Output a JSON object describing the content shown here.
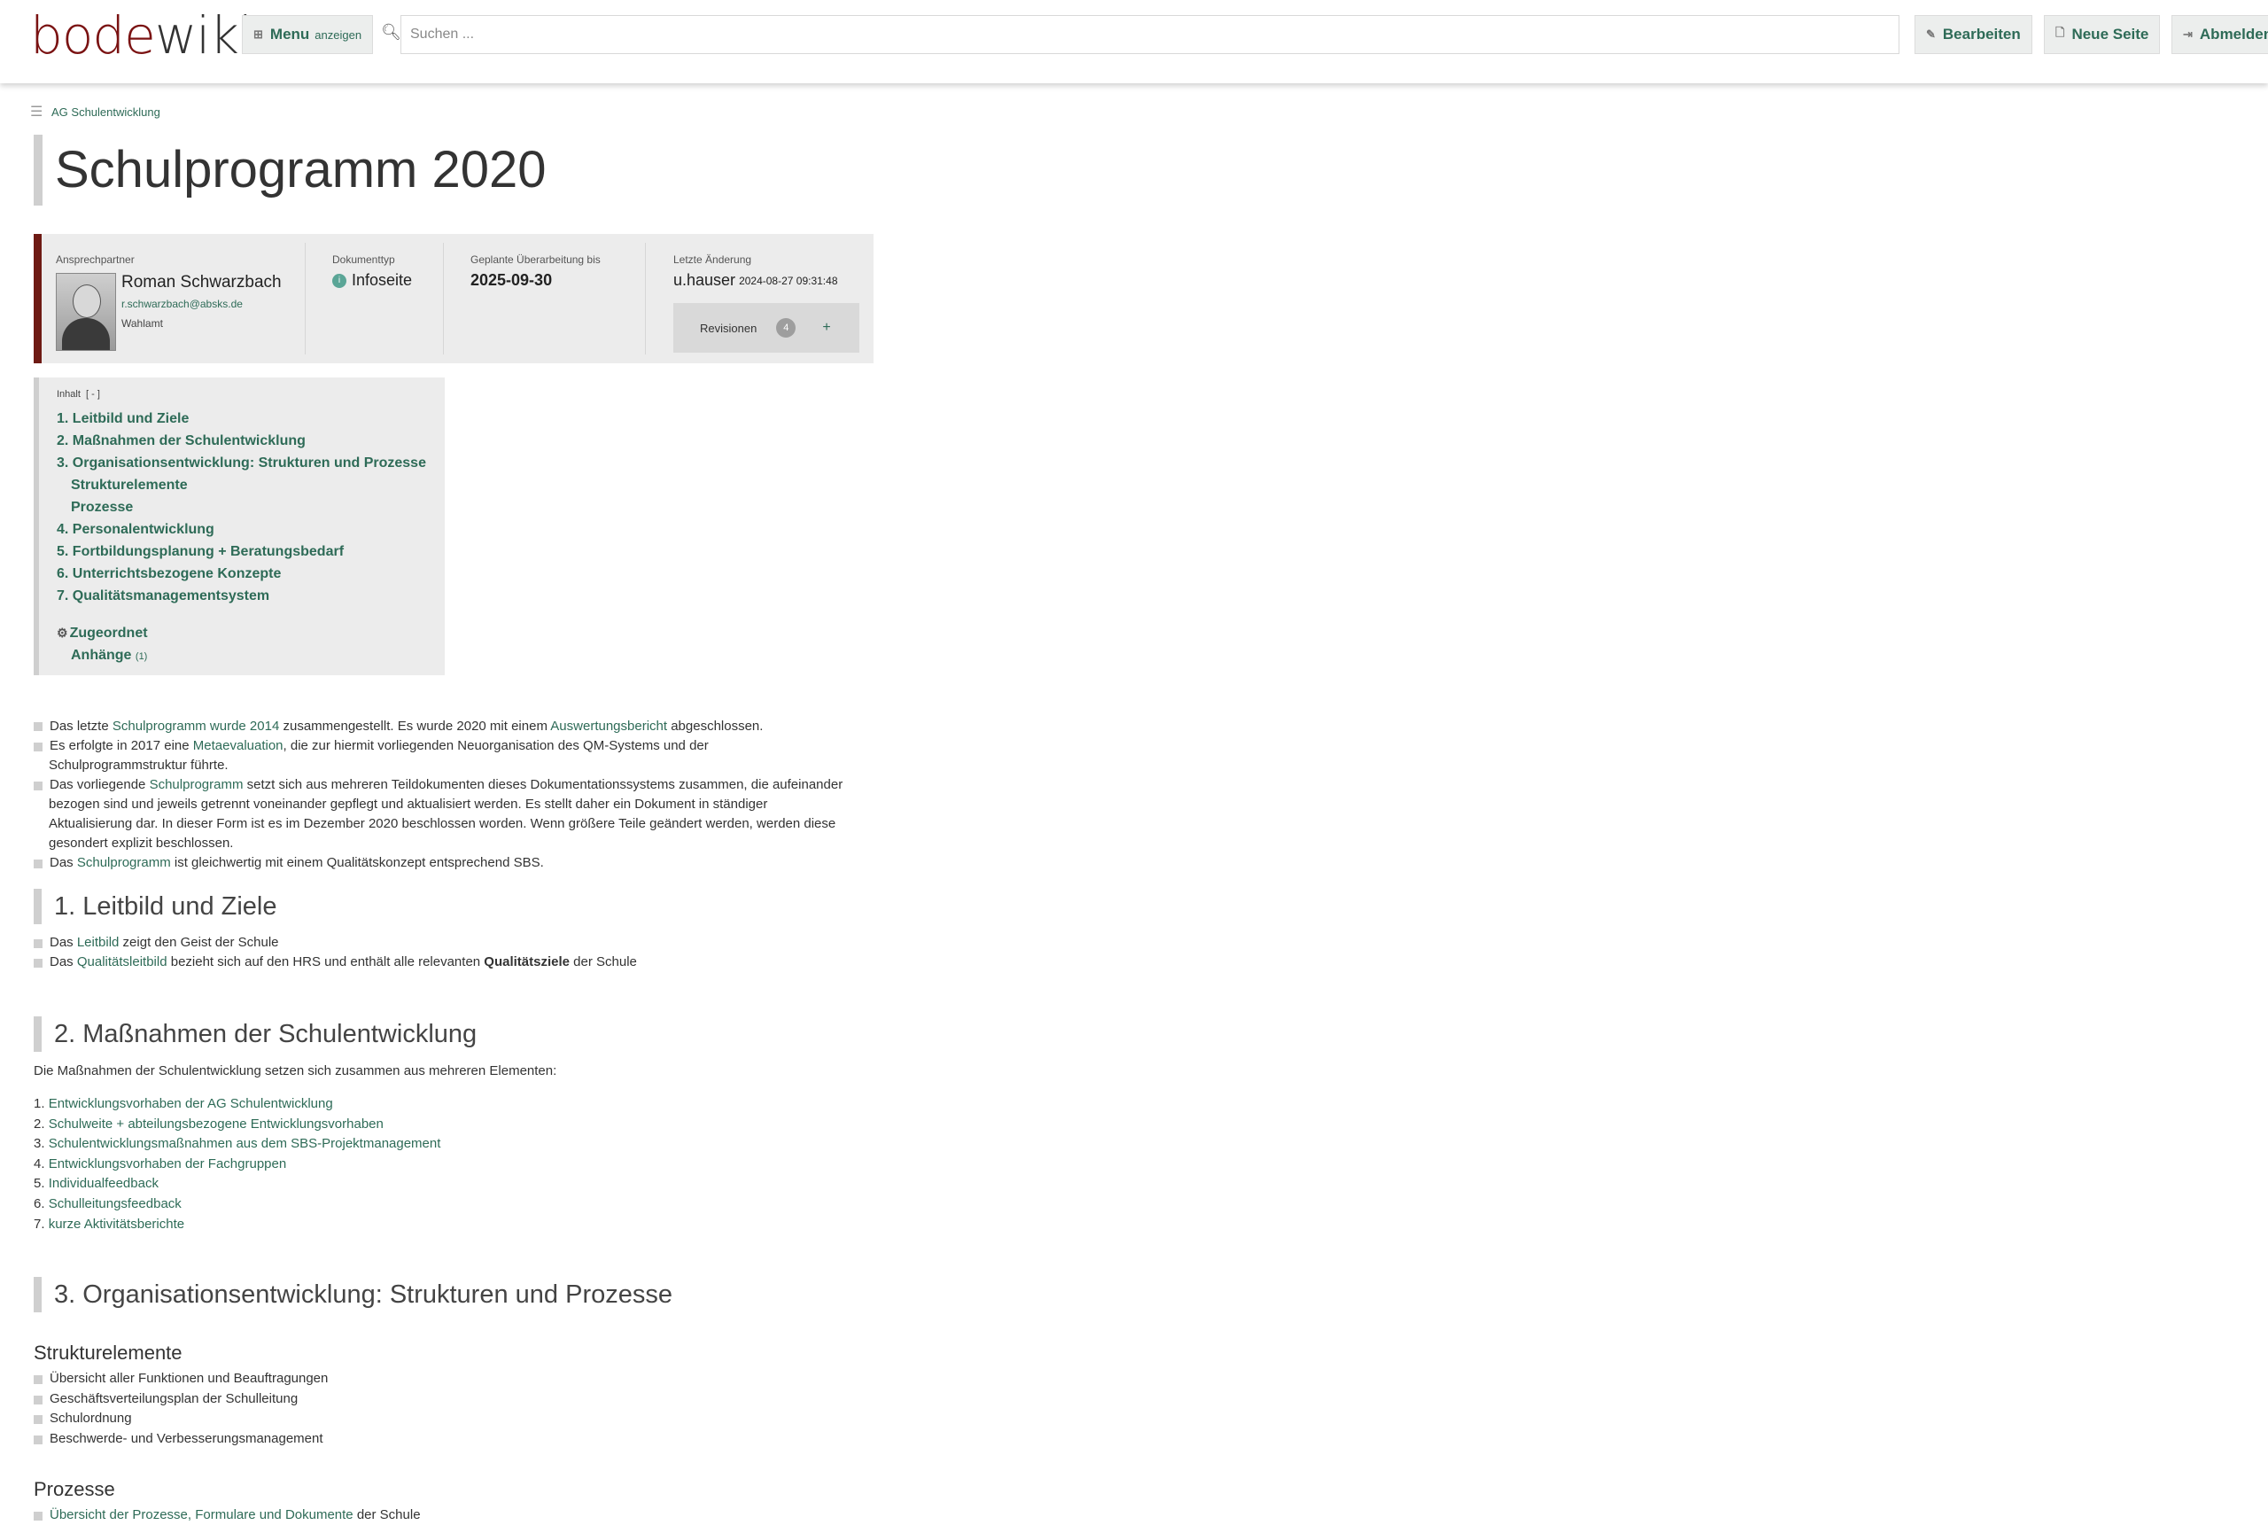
{
  "brand": {
    "part1": "bode",
    "part2": "wiki"
  },
  "header": {
    "menu_label": "Menu",
    "menu_sub": "anzeigen",
    "search_placeholder": "Suchen ...",
    "edit_label": "Bearbeiten",
    "new_page_label": "Neue Seite",
    "logout_label": "Abmelden"
  },
  "breadcrumb": {
    "item": "AG Schulentwicklung"
  },
  "page": {
    "title": "Schulprogramm 2020"
  },
  "info": {
    "contact_label": "Ansprechpartner",
    "contact_name": "Roman Schwarzbach",
    "contact_email": "r.schwarzbach@absks.de",
    "contact_role": "Wahlamt",
    "doctype_label": "Dokumenttyp",
    "doctype_value": "Infoseite",
    "planned_label": "Geplante Überarbeitung bis",
    "planned_value": "2025-09-30",
    "lastchange_label": "Letzte Änderung",
    "lastchange_user": "u.hauser",
    "lastchange_time": "2024-08-27 09:31:48",
    "revisions_label": "Revisionen",
    "revisions_count": "4",
    "revisions_plus": "+"
  },
  "toc": {
    "heading": "Inhalt",
    "toggle": "[ - ]",
    "items": [
      "1. Leitbild und Ziele",
      "2. Maßnahmen der Schulentwicklung",
      "3. Organisationsentwicklung: Strukturen und Prozesse",
      "Strukturelemente",
      "Prozesse",
      "4. Personalentwicklung",
      "5. Fortbildungsplanung + Beratungsbedarf",
      "6. Unterrichtsbezogene Konzepte",
      "7. Qualitätsmanagementsystem"
    ],
    "assigned": "Zugeordnet",
    "attachments": "Anhänge",
    "attachments_count": "(1)"
  },
  "intro": {
    "b1": {
      "t1": "Das letzte ",
      "l1": "Schulprogramm wurde 2014",
      "t2": " zusammengestellt. Es wurde 2020 mit einem ",
      "l2": "Auswertungsbericht",
      "t3": " abgeschlossen."
    },
    "b2": {
      "t1": "Es erfolgte in 2017 eine ",
      "l1": "Metaevaluation",
      "t2": ", die zur hiermit vorliegenden Neuorganisation des QM-Systems und der",
      "line2": "Schulprogrammstruktur führte."
    },
    "b3": {
      "t1": "Das vorliegende ",
      "l1": "Schulprogramm",
      "t2": " setzt sich aus mehreren Teildokumenten dieses Dokumentationssystems zusammen, die aufeinander",
      "line2": "bezogen sind und jeweils getrennt voneinander gepflegt und aktualisiert werden. Es stellt daher ein Dokument in ständiger",
      "line3": "Aktualisierung dar. In dieser Form ist es im Dezember 2020 beschlossen worden. Wenn größere Teile geändert werden, werden diese",
      "line4": "gesondert explizit beschlossen."
    },
    "b4": {
      "t1": "Das ",
      "l1": "Schulprogramm",
      "t2": " ist gleichwertig mit einem Qualitätskonzept entsprechend SBS."
    }
  },
  "sec1": {
    "title": "1. Leitbild und Ziele",
    "b1": {
      "t1": "Das ",
      "l1": "Leitbild",
      "t2": " zeigt den Geist der Schule"
    },
    "b2": {
      "t1": "Das ",
      "l1": "Qualitätsleitbild",
      "t2": " bezieht sich auf den HRS und enthält alle relevanten ",
      "strong": "Qualitätsziele",
      "t3": " der Schule"
    }
  },
  "sec2": {
    "title": "2. Maßnahmen der Schulentwicklung",
    "intro": "Die Maßnahmen der Schulentwicklung setzen sich zusammen aus mehreren Elementen:",
    "items": [
      {
        "n": "1.",
        "label": "Entwicklungsvorhaben der AG Schulentwicklung"
      },
      {
        "n": "2.",
        "label": "Schulweite + abteilungsbezogene Entwicklungsvorhaben"
      },
      {
        "n": "3.",
        "label": "Schulentwicklungsmaßnahmen aus dem SBS-Projektmanagement"
      },
      {
        "n": "4.",
        "label": "Entwicklungsvorhaben der Fachgruppen"
      },
      {
        "n": "5.",
        "label": "Individualfeedback"
      },
      {
        "n": "6.",
        "label": "Schulleitungsfeedback"
      },
      {
        "n": "7.",
        "label": "kurze Aktivitätsberichte"
      }
    ]
  },
  "sec3": {
    "title": "3. Organisationsentwicklung: Strukturen und Prozesse",
    "sub1": "Strukturelemente",
    "sub1_items": [
      "Übersicht aller Funktionen und Beauftragungen",
      "Geschäftsverteilungsplan der Schulleitung",
      "Schulordnung",
      "Beschwerde- und Verbesserungsmanagement"
    ],
    "sub2": "Prozesse",
    "sub2_item": {
      "l1": "Übersicht der Prozesse, Formulare und Dokumente",
      "t1": " der Schule"
    }
  }
}
